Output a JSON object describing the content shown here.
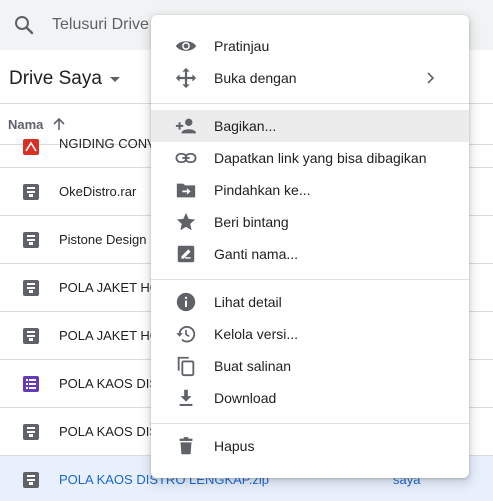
{
  "search": {
    "placeholder": "Telusuri Drive"
  },
  "header": {
    "title": "Drive Saya"
  },
  "columns": {
    "name_label": "Nama"
  },
  "files": [
    {
      "name": "NGIDING CONV",
      "type": "pdf",
      "color": "#d93025"
    },
    {
      "name": "OkeDistro.rar",
      "type": "archive",
      "color": "#5f6368"
    },
    {
      "name": "Pistone Design",
      "type": "archive",
      "color": "#5f6368"
    },
    {
      "name": "POLA JAKET HO",
      "type": "archive",
      "color": "#5f6368"
    },
    {
      "name": "POLA JAKET HO",
      "type": "archive",
      "color": "#5f6368"
    },
    {
      "name": "POLA KAOS DIS",
      "type": "form",
      "color": "#673ab7"
    },
    {
      "name": "POLA KAOS DIS",
      "type": "archive",
      "color": "#5f6368"
    },
    {
      "name": "POLA KAOS DISTRO LENGKAP.zip",
      "type": "archive",
      "color": "#5f6368",
      "owner": "saya",
      "selected": true
    }
  ],
  "menu": {
    "items": [
      {
        "label": "Pratinjau",
        "icon": "eye-icon"
      },
      {
        "label": "Buka dengan",
        "icon": "move-arrows-icon",
        "submenu": true
      },
      {
        "label": "Bagikan...",
        "icon": "person-add-icon",
        "highlighted": true
      },
      {
        "label": "Dapatkan link yang bisa dibagikan",
        "icon": "link-icon"
      },
      {
        "label": "Pindahkan ke...",
        "icon": "folder-move-icon"
      },
      {
        "label": "Beri bintang",
        "icon": "star-icon"
      },
      {
        "label": "Ganti nama...",
        "icon": "edit-icon"
      },
      {
        "label": "Lihat detail",
        "icon": "info-icon"
      },
      {
        "label": "Kelola versi...",
        "icon": "history-icon"
      },
      {
        "label": "Buat salinan",
        "icon": "copy-icon"
      },
      {
        "label": "Download",
        "icon": "download-icon"
      },
      {
        "label": "Hapus",
        "icon": "trash-icon"
      }
    ]
  },
  "colors": {
    "accent": "#1967d2",
    "icon_gray": "#5f6368",
    "selected_bg": "#e8f0fe",
    "menu_hover": "#ececec"
  }
}
